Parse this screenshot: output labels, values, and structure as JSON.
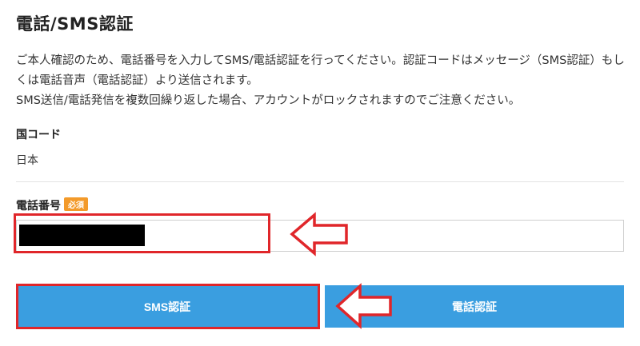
{
  "page": {
    "title": "電話/SMS認証",
    "description": [
      "ご本人確認のため、電話番号を入力してSMS/電話認証を行ってください。認証コードはメッセージ（SMS認証）もしくは電話音声（電話認証）より送信されます。",
      "SMS送信/電話発信を複数回繰り返した場合、アカウントがロックされますのでご注意ください。"
    ]
  },
  "country": {
    "label": "国コード",
    "value": "日本"
  },
  "phone": {
    "label": "電話番号",
    "required_badge": "必須",
    "value": ""
  },
  "buttons": {
    "sms": "SMS認証",
    "voice": "電話認証"
  },
  "colors": {
    "button_blue": "#3a9ee0",
    "highlight_red": "#e0262a",
    "badge_orange": "#f39a2a"
  },
  "icons": {
    "annotation_arrow": "left-arrow-icon"
  }
}
